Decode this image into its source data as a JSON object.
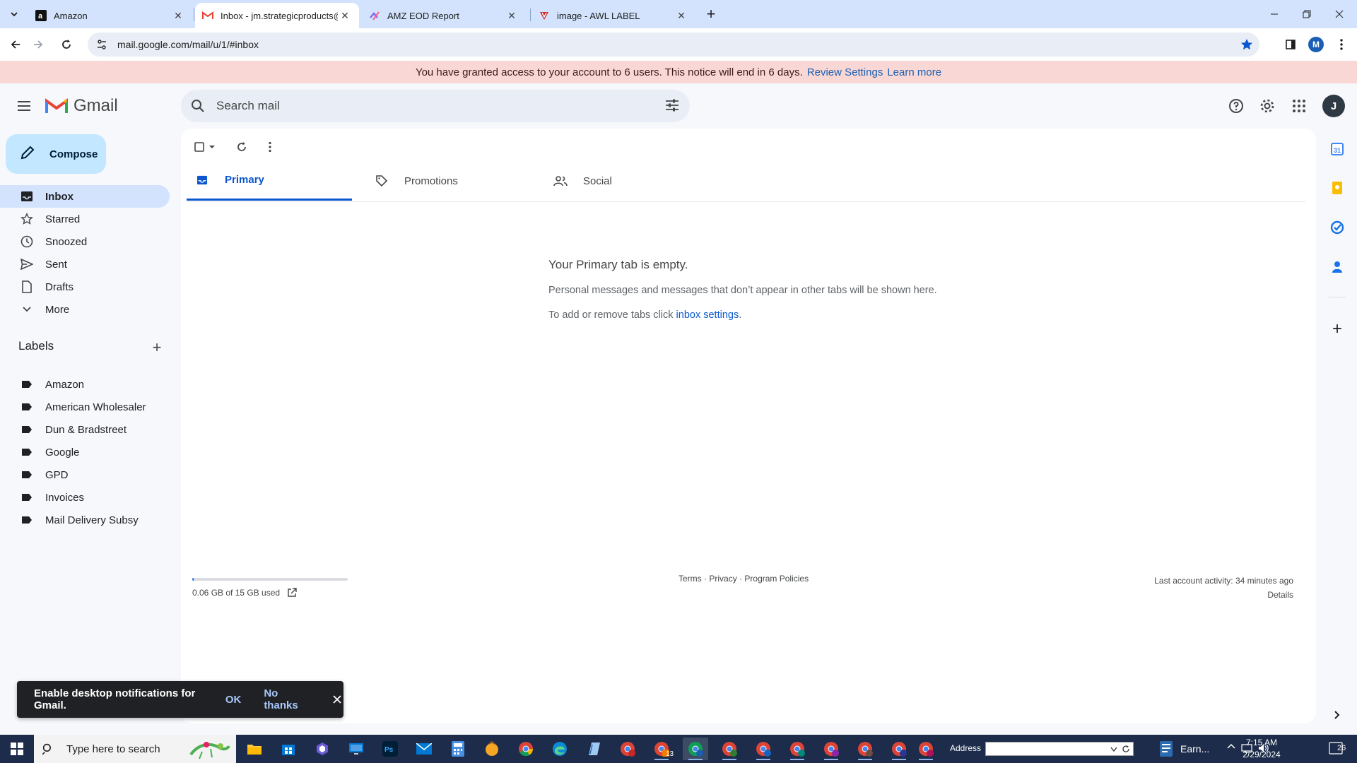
{
  "browser": {
    "tabs": [
      {
        "title": "Amazon",
        "favicon": "amazon-icon"
      },
      {
        "title": "Inbox - jm.strategicproducts@g",
        "favicon": "gmail-icon"
      },
      {
        "title": "AMZ EOD Report",
        "favicon": "clickup-icon"
      },
      {
        "title": "image - AWL LABEL",
        "favicon": "awl-icon"
      }
    ],
    "url": "mail.google.com/mail/u/1/#inbox",
    "profile_initial": "M"
  },
  "notice": {
    "text": "You have granted access to your account to 6 users. This notice will end in 6 days.",
    "review_link": "Review Settings",
    "learn_link": "Learn more"
  },
  "header": {
    "logo_text": "Gmail",
    "search_placeholder": "Search mail",
    "avatar_initial": "J"
  },
  "sidebar": {
    "compose_label": "Compose",
    "items": [
      {
        "label": "Inbox",
        "icon": "inbox-icon",
        "active": true
      },
      {
        "label": "Starred",
        "icon": "star-icon"
      },
      {
        "label": "Snoozed",
        "icon": "clock-icon"
      },
      {
        "label": "Sent",
        "icon": "send-icon"
      },
      {
        "label": "Drafts",
        "icon": "draft-icon"
      },
      {
        "label": "More",
        "icon": "chevron-down-icon"
      }
    ],
    "labels_heading": "Labels",
    "labels": [
      "Amazon",
      "American Wholesaler",
      "Dun & Bradstreet",
      "Google",
      "GPD",
      "Invoices",
      "Mail Delivery Subsy"
    ]
  },
  "main": {
    "tabs": [
      {
        "label": "Primary",
        "icon": "inbox-icon",
        "active": true
      },
      {
        "label": "Promotions",
        "icon": "tag-icon"
      },
      {
        "label": "Social",
        "icon": "people-icon"
      }
    ],
    "empty_title": "Your Primary tab is empty.",
    "empty_line1": "Personal messages and messages that don’t appear in other tabs will be shown here.",
    "empty_line2_prefix": "To add or remove tabs click",
    "empty_line2_link": "inbox settings",
    "empty_line2_suffix": ".",
    "storage_text": "0.06 GB of 15 GB used",
    "storage_fraction": 0.004,
    "footer_terms": "Terms",
    "footer_privacy": "Privacy",
    "footer_policies": "Program Policies",
    "footer_sep": "·",
    "last_activity": "Last account activity: 34 minutes ago",
    "details": "Details"
  },
  "snackbar": {
    "message": "Enable desktop notifications for Gmail.",
    "ok": "OK",
    "no_thanks": "No thanks"
  },
  "taskbar": {
    "search_placeholder": "Type here to search",
    "address_label": "Address",
    "weather": "Earn...",
    "time": "7:15 AM",
    "date": "2/29/2024",
    "notifications": "26",
    "chrome_badge": "13"
  }
}
